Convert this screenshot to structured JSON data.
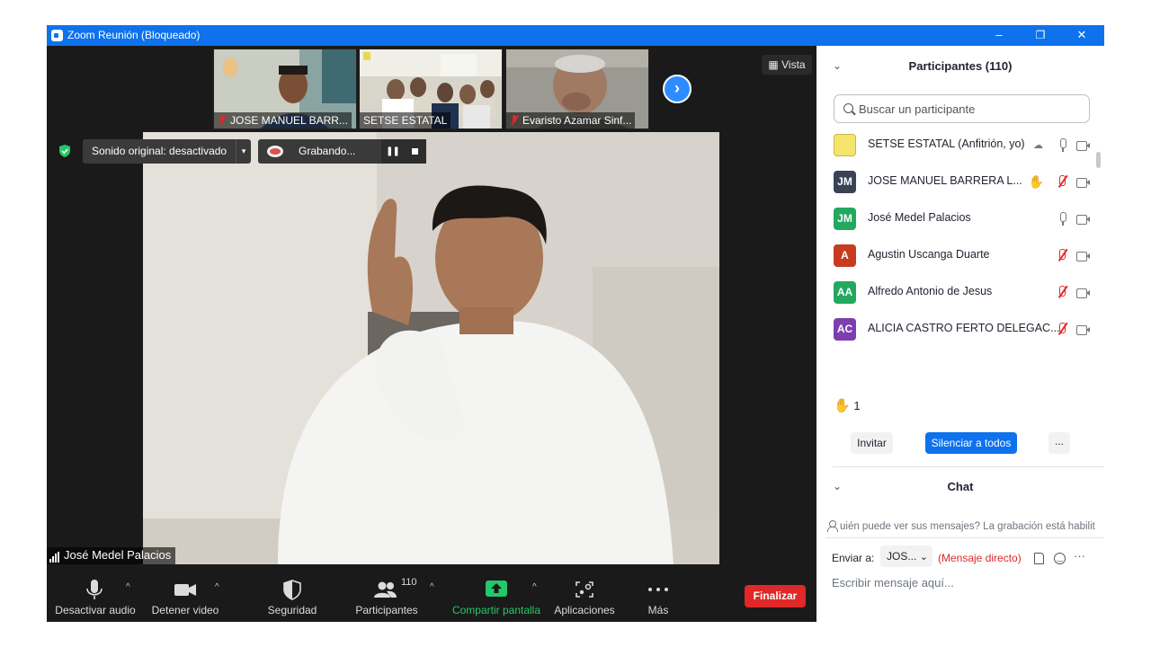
{
  "window": {
    "title": "Zoom Reunión (Bloqueado)",
    "minimize": "–",
    "restore": "❐",
    "close": "✕"
  },
  "thumbnails": [
    {
      "name": "JOSE MANUEL BARR...",
      "muted": true
    },
    {
      "name": "SETSE ESTATAL",
      "muted": false
    },
    {
      "name": "Evaristo Azamar Sinf...",
      "muted": true
    }
  ],
  "view_button": "Vista",
  "next_arrow": "›",
  "sound": {
    "label": "Sonido original: desactivado",
    "caret": "▾"
  },
  "recording": {
    "label": "Grabando...",
    "pause": "❚❚"
  },
  "active_speaker": "José Medel Palacios",
  "toolbar": {
    "mute": "Desactivar audio",
    "video": "Detener video",
    "security": "Seguridad",
    "participants": "Participantes",
    "participant_count": "110",
    "share": "Compartir pantalla",
    "apps": "Aplicaciones",
    "more": "Más",
    "end": "Finalizar",
    "caret": "^"
  },
  "panel": {
    "participants_title": "Participantes (110)",
    "search_placeholder": "Buscar un participante",
    "participants": [
      {
        "initials": "",
        "name": "SETSE ESTATAL (Anfitrión, yo)",
        "color": "#f5e46b",
        "mic": "on",
        "cloud": true,
        "hand": false
      },
      {
        "initials": "JM",
        "name": "JOSE MANUEL BARRERA L...",
        "color": "#3a4256",
        "mic": "off",
        "cloud": false,
        "hand": true
      },
      {
        "initials": "JM",
        "name": "José Medel Palacios",
        "color": "#23a860",
        "mic": "on",
        "cloud": false,
        "hand": false
      },
      {
        "initials": "A",
        "name": "Agustin Uscanga Duarte",
        "color": "#c73b1f",
        "mic": "off",
        "cloud": false,
        "hand": false
      },
      {
        "initials": "AA",
        "name": "Alfredo Antonio de Jesus",
        "color": "#23a860",
        "mic": "off",
        "cloud": false,
        "hand": false
      },
      {
        "initials": "AC",
        "name": "ALICIA CASTRO FERTO DELEGAC...",
        "color": "#7b3fb0",
        "mic": "off",
        "cloud": false,
        "hand": false
      }
    ],
    "raised_hand_count": "1",
    "invite": "Invitar",
    "mute_all": "Silenciar a todos",
    "more": "...",
    "chat_title": "Chat",
    "chat_info": "uién puede ver sus mensajes? La grabación está habilit",
    "send_to_label": "Enviar a:",
    "recipient": "JOS...",
    "recipient_caret": "⌄",
    "direct_message": "(Mensaje directo)",
    "chat_more": "···",
    "chat_placeholder": "Escribir mensaje aquí..."
  },
  "colors": {
    "accent": "#0e72ed",
    "end": "#e02828",
    "share": "#23c86b",
    "hand": "#f5b335"
  }
}
